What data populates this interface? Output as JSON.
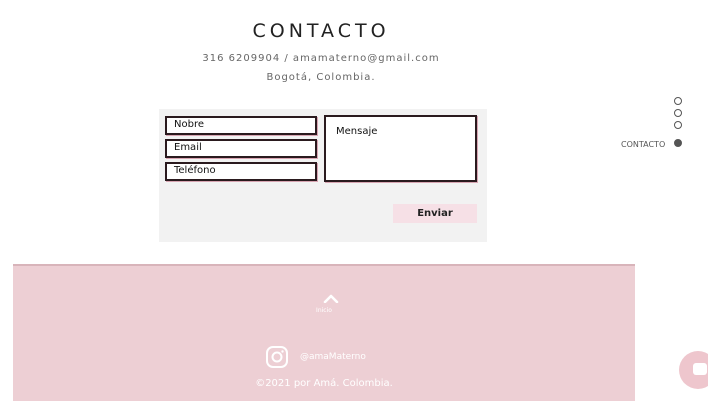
{
  "contact": {
    "title": "CONTACTO",
    "phone_email": "316 6209904 / amamaterno@gmail.com",
    "city": "Bogotá, Colombia."
  },
  "form": {
    "name_placeholder": "Nobre",
    "email_placeholder": "Email",
    "phone_placeholder": "Teléfono",
    "message_placeholder": "Mensaje",
    "submit_label": "Enviar"
  },
  "section_nav": {
    "items": [
      "",
      "",
      "",
      "CONTACTO"
    ],
    "active_label": "CONTACTO"
  },
  "footer": {
    "back_to_top_label": "Inicio",
    "instagram_handle": "@amaMaterno",
    "copyright": "©2021 por Amá. Colombia."
  },
  "colors": {
    "footer_bg": "#edcfd4",
    "button_bg": "#f6e0e6",
    "form_bg": "#f2f2f2"
  },
  "icons": {
    "back_to_top": "chevron-up-icon",
    "instagram": "instagram-icon",
    "chat": "chat-icon"
  }
}
